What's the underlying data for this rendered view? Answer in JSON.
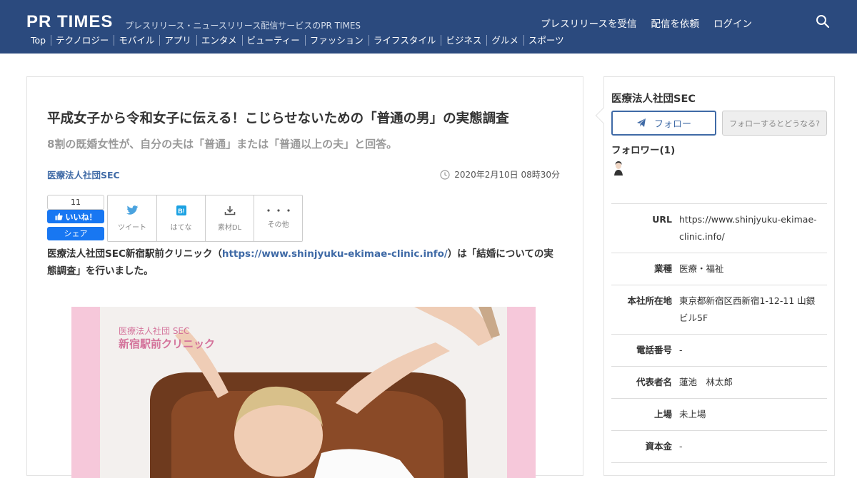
{
  "header": {
    "logo_text": "PR TIMES",
    "tagline": "プレスリリース・ニュースリリース配信サービスのPR TIMES",
    "links": [
      "プレスリリースを受信",
      "配信を依頼",
      "ログイン"
    ],
    "categories": [
      "Top",
      "テクノロジー",
      "モバイル",
      "アプリ",
      "エンタメ",
      "ビューティー",
      "ファッション",
      "ライフスタイル",
      "ビジネス",
      "グルメ",
      "スポーツ"
    ]
  },
  "article": {
    "title": "平成女子から令和女子に伝える！こじらせないための「普通の男」の実態調査",
    "subtitle": "8割の既婚女性が、自分の夫は「普通」または「普通以上の夫」と回答。",
    "company": "医療法人社団SEC",
    "date": "2020年2月10日 08時30分",
    "like_count": "11",
    "like_label": "いいね！",
    "share_label": "シェア",
    "tools": [
      {
        "label": "ツイート",
        "icon": "twitter-icon"
      },
      {
        "label": "はてな",
        "icon": "hatena-icon"
      },
      {
        "label": "素材DL",
        "icon": "download-icon"
      },
      {
        "label": "その他",
        "icon": "more-icon"
      }
    ],
    "body_prefix": "医療法人社団SEC新宿駅前クリニック（",
    "body_link": "https://www.shinjyuku-ekimae-clinic.info/",
    "body_suffix": "）は「結婚についての実態調査」を行いました。",
    "image_caption_small": "医療法人社団 SEC",
    "image_caption_big": "新宿駅前クリニック"
  },
  "sidebar": {
    "company_name": "医療法人社団SEC",
    "follow_label": "フォロー",
    "follow_help": "フォローするとどうなる?",
    "followers": "フォロワー(1)",
    "info": [
      {
        "key": "URL",
        "value": "https://www.shinjyuku-ekimae-clinic.info/"
      },
      {
        "key": "業種",
        "value": "医療・福祉"
      },
      {
        "key": "本社所在地",
        "value": "東京都新宿区西新宿1-12-11 山銀ビル5F"
      },
      {
        "key": "電話番号",
        "value": " -"
      },
      {
        "key": "代表者名",
        "value": "蓮池　林太郎"
      },
      {
        "key": "上場",
        "value": "未上場"
      },
      {
        "key": "資本金",
        "value": "-"
      }
    ]
  },
  "colors": {
    "header_bg": "#2b4a7e",
    "link": "#3f6aa6",
    "facebook": "#1877f2",
    "hero_pink": "#f6c8da"
  }
}
